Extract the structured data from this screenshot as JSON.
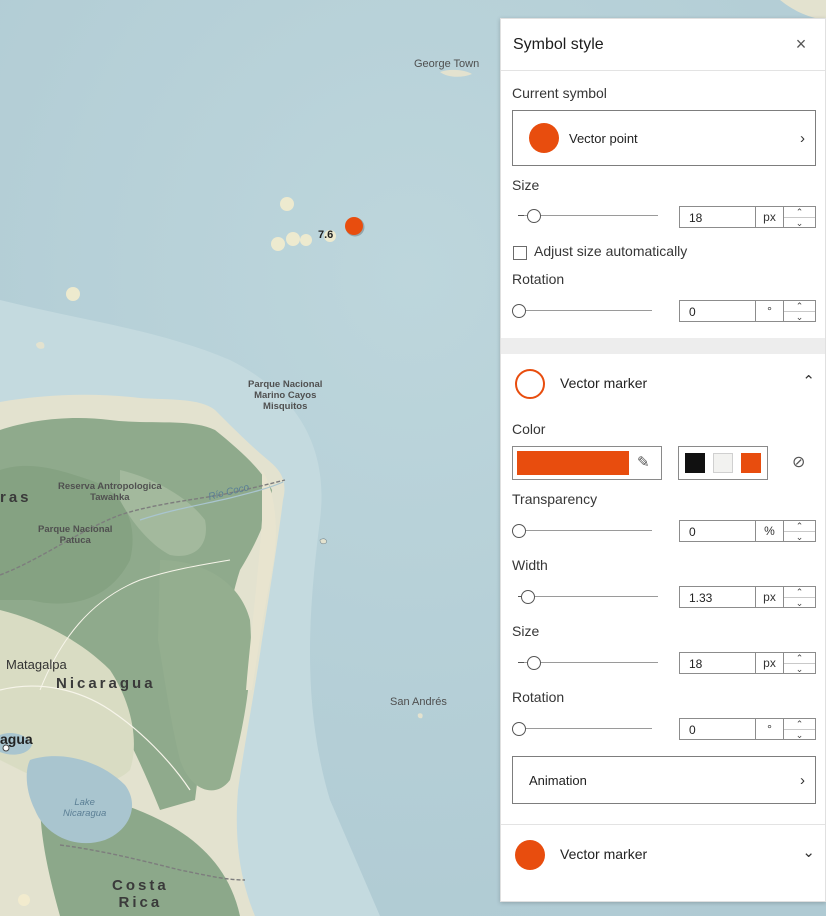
{
  "map": {
    "labels": {
      "george_town": "George Town",
      "park_cayos": "Parque Nacional\nMarino Cayos\nMisquitos",
      "reserva": "Reserva Antropologica\nTawahka",
      "park_patuca": "Parque Nacional\nPatuca",
      "rio_coco": "Río Coco",
      "honduras_partial": "ras",
      "matagalpa": "Matagalpa",
      "nicaragua": "Nicaragua",
      "managua_partial": "agua",
      "lake": "Lake\nNicaragua",
      "san_andres": "San Andrés",
      "costa_rica": "Costa\nRica",
      "point_value": "7.6"
    },
    "colors": {
      "water": "#b8d2d9",
      "land": "#e3e2cf",
      "forest": "#8faa8c",
      "point_accent": "#e84d0e",
      "faded_point": "#f3eccd"
    }
  },
  "panel": {
    "title": "Symbol style",
    "close_icon": "×",
    "current_symbol": {
      "label": "Current symbol",
      "card_label": "Vector point",
      "color": "#e84d0e"
    },
    "top_size": {
      "label": "Size",
      "value": "18",
      "unit": "px",
      "slider_fraction": 0.12
    },
    "adjust_auto": {
      "label": "Adjust size automatically",
      "checked": false
    },
    "top_rotation": {
      "label": "Rotation",
      "value": "0",
      "unit": "°",
      "slider_fraction": 0
    },
    "marker_section": {
      "title": "Vector marker",
      "expanded": true,
      "color": {
        "label": "Color",
        "current": "#e84d0e",
        "recent": [
          "#111111",
          "#f2f2f0",
          "#e84d0e"
        ]
      },
      "transparency": {
        "label": "Transparency",
        "value": "0",
        "unit": "%",
        "slider_fraction": 0
      },
      "width": {
        "label": "Width",
        "value": "1.33",
        "unit": "px",
        "slider_fraction": 0.08
      },
      "size": {
        "label": "Size",
        "value": "18",
        "unit": "px",
        "slider_fraction": 0.12
      },
      "rotation": {
        "label": "Rotation",
        "value": "0",
        "unit": "°",
        "slider_fraction": 0
      },
      "animation_label": "Animation"
    },
    "fill_section": {
      "title": "Vector marker",
      "expanded": false,
      "color": "#e84d0e"
    }
  }
}
